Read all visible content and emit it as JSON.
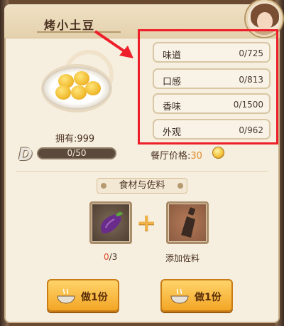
{
  "dish": {
    "title": "烤小土豆",
    "own": "拥有:999",
    "progress": {
      "text": "0/50",
      "value": 0,
      "max": 50
    }
  },
  "stats": [
    {
      "label": "味道",
      "value": "0/725"
    },
    {
      "label": "口感",
      "value": "0/813"
    },
    {
      "label": "香味",
      "value": "0/1500"
    },
    {
      "label": "外观",
      "value": "0/962"
    }
  ],
  "price": {
    "label": "餐厅价格:",
    "value": "30"
  },
  "section": {
    "title": "食材与佐料"
  },
  "ingredients": {
    "count_current": "0",
    "count_total": "/3",
    "add_seasoning": "添加佐料"
  },
  "buttons": [
    {
      "label": "做1份"
    },
    {
      "label": "做1份"
    }
  ],
  "colors": {
    "highlight": "#ee1e2a",
    "button": "#f3a626",
    "accent": "#e08a2a"
  }
}
